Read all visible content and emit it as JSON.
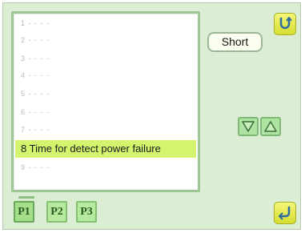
{
  "list": {
    "items": [
      {
        "label": "1 - - - -"
      },
      {
        "label": "2 - - - -"
      },
      {
        "label": "3 - - - -"
      },
      {
        "label": "4 - - - -"
      },
      {
        "label": "5 - - - -"
      },
      {
        "label": "6 - - - -"
      },
      {
        "label": "7 - - - -"
      },
      {
        "label": "8 Time for detect power failure"
      },
      {
        "label": "9 - - - -"
      }
    ],
    "selected_index": 7
  },
  "value_button": {
    "label": "Short"
  },
  "page_tabs": [
    {
      "label": "P1"
    },
    {
      "label": "P2"
    },
    {
      "label": "P3"
    }
  ],
  "icons": {
    "undo": "undo-arrow-icon",
    "enter": "enter-return-icon",
    "down": "triangle-down-icon",
    "up": "triangle-up-icon"
  },
  "colors": {
    "background": "#dbedd3",
    "selection": "#d4f46e",
    "accent_yellow": "#e6eb4c",
    "tab_green": "#b5ea9f"
  }
}
